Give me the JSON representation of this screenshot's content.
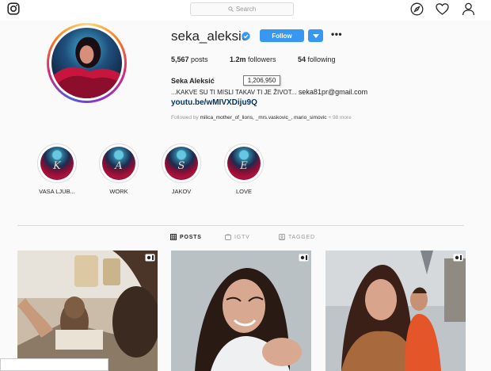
{
  "header": {
    "search_placeholder": "Search",
    "icons": [
      "instagram-icon",
      "explore-compass-icon",
      "heart-icon",
      "profile-icon"
    ]
  },
  "profile": {
    "username": "seka_aleksic",
    "verified": true,
    "follow_label": "Follow",
    "more_label": "•••",
    "posts_count": "5,567",
    "posts_label": "posts",
    "followers_count": "1.2m",
    "followers_label": "followers",
    "following_count": "54",
    "following_label": "following",
    "full_name": "Seka Aleksić",
    "tooltip": "1,206,950",
    "bio": "...KAKVE SU TI MISLI TAKAV TI JE ŽIVOT...",
    "email": " seka81pr@gmail.com",
    "link": "youtu.be/wMIVXDiju9Q",
    "followed_by_prefix": "Followed by ",
    "followed_by_names": "milica_mother_of_lions, _mrs.vaskovic_, mario_simovic",
    "followed_by_more": " + 98 more"
  },
  "highlights": [
    {
      "letter": "K",
      "label": "VASA LJUB..."
    },
    {
      "letter": "A",
      "label": "WORK"
    },
    {
      "letter": "S",
      "label": "JAKOV"
    },
    {
      "letter": "E",
      "label": "LOVE"
    }
  ],
  "tabs": {
    "posts": "POSTS",
    "igtv": "IGTV",
    "tagged": "TAGGED"
  },
  "colors": {
    "accent": "#3897f0",
    "link": "#003569",
    "background": "#fafafa"
  }
}
